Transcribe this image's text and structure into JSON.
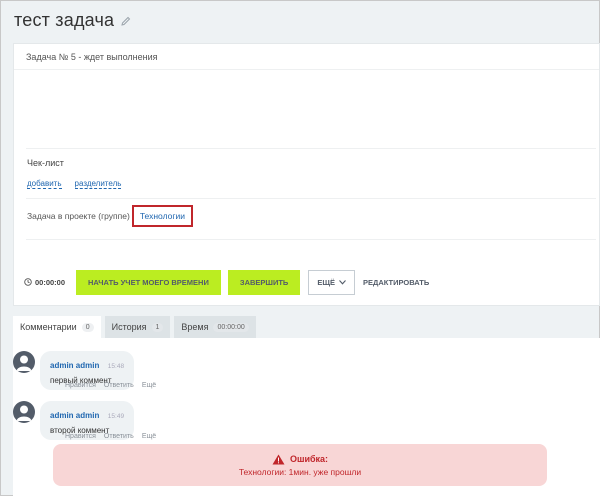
{
  "header": {
    "title": "тест задача"
  },
  "task": {
    "status_line": "Задача № 5 - ждет выполнения",
    "checklist": {
      "title": "Чек-лист",
      "add_link": "добавить",
      "separator_link": "разделитель"
    },
    "project": {
      "label": "Задача в проекте (группе)",
      "name": "Технологии"
    }
  },
  "actions": {
    "timer": "00:00:00",
    "start_time_tracking": "НАЧАТЬ УЧЕТ МОЕГО ВРЕМЕНИ",
    "finish": "ЗАВЕРШИТЬ",
    "more": "ЕЩЁ",
    "edit": "РЕДАКТИРОВАТЬ"
  },
  "tabs": [
    {
      "label": "Комментарии",
      "badge": "0"
    },
    {
      "label": "История",
      "badge": "1"
    },
    {
      "label": "Время",
      "badge": "00:00:00"
    }
  ],
  "comments": [
    {
      "author": "admin admin",
      "time": "15:48",
      "text": "первый коммент",
      "actions": [
        "Нравится",
        "Ответить",
        "Ещё"
      ]
    },
    {
      "author": "admin admin",
      "time": "15:49",
      "text": "второй коммент",
      "actions": [
        "Нравится",
        "Ответить",
        "Ещё"
      ]
    }
  ],
  "error": {
    "title": "Ошибка:",
    "message": "Технологии: 1мин. уже прошли"
  },
  "colors": {
    "accent_green": "#bbed21",
    "link_blue": "#2067b0",
    "error_red": "#c0262b",
    "error_bg": "#f8d6d6"
  }
}
